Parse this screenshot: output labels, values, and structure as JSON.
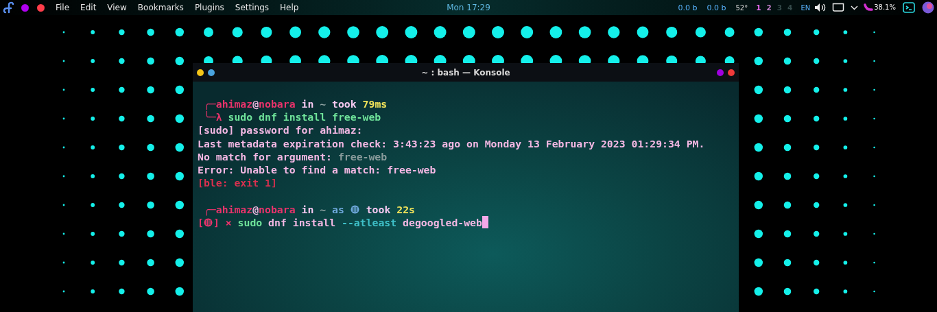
{
  "top_bar": {
    "menu": [
      "File",
      "Edit",
      "View",
      "Bookmarks",
      "Plugins",
      "Settings",
      "Help"
    ],
    "clock": "Mon 17:29",
    "net_down": "0.0 b",
    "net_up": "0.0 b",
    "temperature": "52°",
    "workspaces": [
      {
        "label": "1",
        "selected": true,
        "occupied": true
      },
      {
        "label": "2",
        "selected": false,
        "occupied": true
      },
      {
        "label": "3",
        "selected": false,
        "occupied": false
      },
      {
        "label": "4",
        "selected": false,
        "occupied": false
      }
    ],
    "keyboard_layout": "EN",
    "battery": "38.1%"
  },
  "terminal": {
    "title": "~ : bash — Konsole",
    "lines": [
      {
        "segments": [
          {
            "text": " ╭─ahimaz",
            "color": "#e8336b"
          },
          {
            "text": "@",
            "color": "#f4b8e4"
          },
          {
            "text": "nobara",
            "color": "#e8336b"
          },
          {
            "text": " in ",
            "color": "#f4c8f0"
          },
          {
            "text": "~",
            "color": "#8fa3a3"
          },
          {
            "text": " took ",
            "color": "#f4c8f0"
          },
          {
            "text": "79ms",
            "color": "#f2e35a"
          }
        ]
      },
      {
        "segments": [
          {
            "text": " ╰─λ ",
            "color": "#e8336b"
          },
          {
            "text": "sudo dnf install free-web",
            "color": "#6fe39a"
          }
        ]
      },
      {
        "segments": [
          {
            "text": "[sudo] password for ahimaz:",
            "color": "#f4b8e4"
          }
        ]
      },
      {
        "segments": [
          {
            "text": "Last metadata expiration check: 3:43:23 ago on Monday 13 February 2023 01:29:34 PM.",
            "color": "#f4b8e4"
          }
        ]
      },
      {
        "segments": [
          {
            "text": "No match for argument: ",
            "color": "#f4b8e4"
          },
          {
            "text": "free-web",
            "color": "#8a9c9c"
          }
        ]
      },
      {
        "segments": [
          {
            "text": "Error: Unable to find a match: free-web",
            "color": "#f4b8e4"
          }
        ]
      },
      {
        "segments": [
          {
            "text": "[ble: exit 1]",
            "color": "#d9304f"
          }
        ]
      },
      {
        "blank_before": true,
        "segments": [
          {
            "text": " ╭─ahimaz",
            "color": "#e8336b"
          },
          {
            "text": "@",
            "color": "#f4b8e4"
          },
          {
            "text": "nobara",
            "color": "#e8336b"
          },
          {
            "text": " in ",
            "color": "#f4c8f0"
          },
          {
            "text": "~",
            "color": "#8fa3a3"
          },
          {
            "text": " as ",
            "color": "#6fa8dc"
          },
          {
            "kind": "icon",
            "color": "#6fa8dc"
          },
          {
            "text": " took ",
            "color": "#f4c8f0"
          },
          {
            "text": "22s",
            "color": "#f2e35a"
          }
        ]
      },
      {
        "cursor": true,
        "segments": [
          {
            "text": "[",
            "color": "#e8336b"
          },
          {
            "kind": "icon",
            "color": "#e8336b"
          },
          {
            "text": "] × ",
            "color": "#e8336b"
          },
          {
            "text": "sudo ",
            "color": "#6fe39a"
          },
          {
            "text": "dnf install ",
            "color": "#f4b8e4"
          },
          {
            "text": "--atleast ",
            "color": "#3fc1c9"
          },
          {
            "text": "degoogled-web",
            "color": "#f4b8e4"
          }
        ]
      }
    ]
  }
}
